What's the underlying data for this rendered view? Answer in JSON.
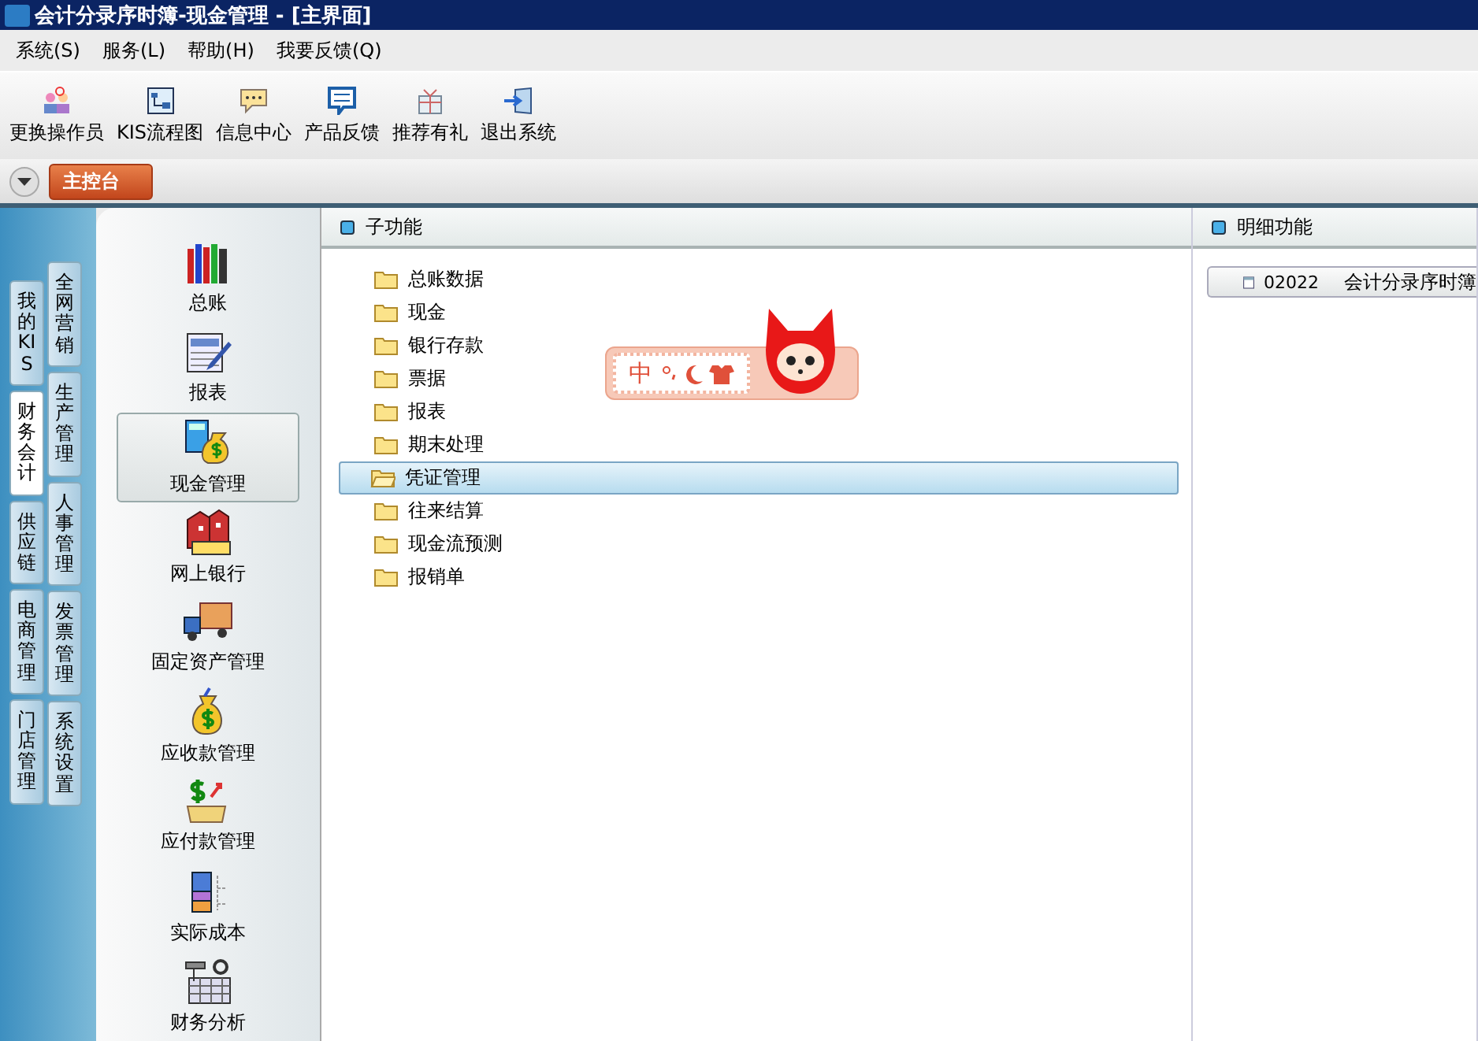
{
  "window": {
    "title": "会计分录序时簿-现金管理 - [主界面]"
  },
  "menu": [
    {
      "label": "系统(S)"
    },
    {
      "label": "服务(L)"
    },
    {
      "label": "帮助(H)"
    },
    {
      "label": "我要反馈(Q)"
    }
  ],
  "toolbar": [
    {
      "label": "更换操作员"
    },
    {
      "label": "KIS流程图"
    },
    {
      "label": "信息中心"
    },
    {
      "label": "产品反馈"
    },
    {
      "label": "推荐有礼"
    },
    {
      "label": "退出系统"
    }
  ],
  "doc_tabs": [
    {
      "label": "主控台",
      "selected": true
    }
  ],
  "side_tabs_outer": [
    {
      "label": "我的KIS",
      "selected": false
    },
    {
      "label": "财务会计",
      "selected": true
    },
    {
      "label": "供应链",
      "selected": false
    },
    {
      "label": "电商管理",
      "selected": false
    },
    {
      "label": "门店管理",
      "selected": false
    }
  ],
  "side_tabs_inner": [
    {
      "label": "全网营销",
      "selected": false
    },
    {
      "label": "生产管理",
      "selected": false
    },
    {
      "label": "人事管理",
      "selected": false
    },
    {
      "label": "发票管理",
      "selected": false
    },
    {
      "label": "系统设置",
      "selected": false
    }
  ],
  "modules": [
    {
      "label": "总账",
      "selected": false
    },
    {
      "label": "报表",
      "selected": false
    },
    {
      "label": "现金管理",
      "selected": true
    },
    {
      "label": "网上银行",
      "selected": false
    },
    {
      "label": "固定资产管理",
      "selected": false
    },
    {
      "label": "应收款管理",
      "selected": false
    },
    {
      "label": "应付款管理",
      "selected": false
    },
    {
      "label": "实际成本",
      "selected": false
    },
    {
      "label": "财务分析",
      "selected": false
    }
  ],
  "sub_panel": {
    "title": "子功能",
    "items": [
      {
        "label": "总账数据",
        "selected": false
      },
      {
        "label": "现金",
        "selected": false
      },
      {
        "label": "银行存款",
        "selected": false
      },
      {
        "label": "票据",
        "selected": false
      },
      {
        "label": "报表",
        "selected": false
      },
      {
        "label": "期末处理",
        "selected": false
      },
      {
        "label": "凭证管理",
        "selected": true
      },
      {
        "label": "往来结算",
        "selected": false
      },
      {
        "label": "现金流预测",
        "selected": false
      },
      {
        "label": "报销单",
        "selected": false
      }
    ]
  },
  "detail_panel": {
    "title": "明细功能",
    "items": [
      {
        "code": "02022",
        "label": "会计分录序时簿"
      }
    ]
  },
  "ime_bar": {
    "mode": "中"
  }
}
